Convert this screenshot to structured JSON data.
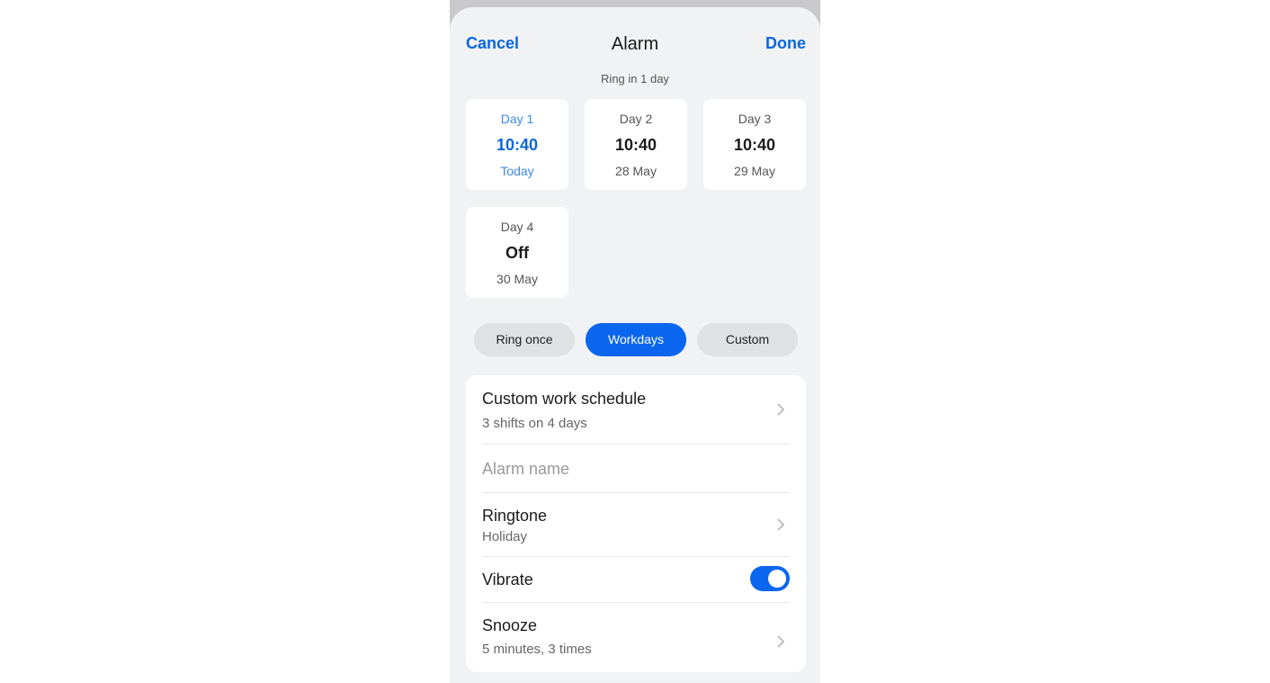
{
  "header": {
    "cancel_label": "Cancel",
    "title": "Alarm",
    "done_label": "Done",
    "subtitle": "Ring in 1 day"
  },
  "days": [
    {
      "label": "Day 1",
      "time": "10:40",
      "date": "Today",
      "selected": true
    },
    {
      "label": "Day 2",
      "time": "10:40",
      "date": "28 May",
      "selected": false
    },
    {
      "label": "Day 3",
      "time": "10:40",
      "date": "29 May",
      "selected": false
    },
    {
      "label": "Day 4",
      "time": "Off",
      "date": "30 May",
      "selected": false
    }
  ],
  "repeat_options": [
    {
      "label": "Ring once",
      "selected": false
    },
    {
      "label": "Workdays",
      "selected": true
    },
    {
      "label": "Custom",
      "selected": false
    }
  ],
  "settings": {
    "work_schedule": {
      "title": "Custom work schedule",
      "value": "3 shifts on 4 days"
    },
    "alarm_name": {
      "placeholder": "Alarm name"
    },
    "ringtone": {
      "title": "Ringtone",
      "value": "Holiday"
    },
    "vibrate": {
      "title": "Vibrate",
      "enabled": true
    },
    "snooze": {
      "title": "Snooze",
      "value": "5 minutes, 3 times"
    }
  },
  "icons": {
    "chevron": "chevron-right-icon"
  },
  "colors": {
    "accent": "#0a66ef",
    "accent_text": "#0a66e0",
    "selected_day_light": "#3d8ae8",
    "background": "#f1f2f4",
    "card": "#ffffff"
  }
}
